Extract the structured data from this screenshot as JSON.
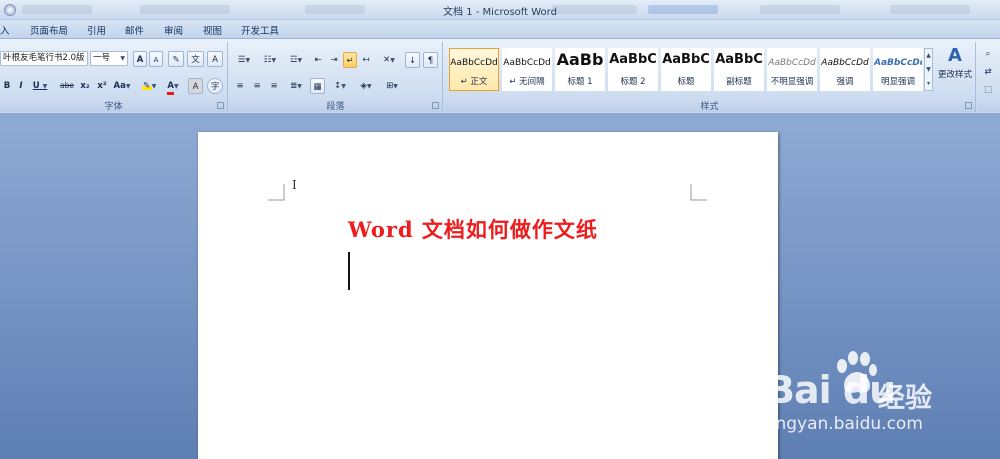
{
  "window": {
    "title": "文档 1 - Microsoft Word"
  },
  "tabs": [
    {
      "id": "insert",
      "label": "入"
    },
    {
      "id": "layout",
      "label": "页面布局"
    },
    {
      "id": "references",
      "label": "引用"
    },
    {
      "id": "mailings",
      "label": "邮件"
    },
    {
      "id": "review",
      "label": "审阅"
    },
    {
      "id": "view",
      "label": "视图"
    },
    {
      "id": "developer",
      "label": "开发工具"
    }
  ],
  "font_group": {
    "label": "字体",
    "font_name": "叶根友毛笔行书2.0版",
    "font_size": "一号",
    "grow": "A",
    "shrink": "A",
    "bold": "B",
    "italic": "I",
    "underline": "U",
    "strike": "abe",
    "subscript": "x₂",
    "superscript": "x²",
    "change_case": "Aa",
    "font_color": "A",
    "char_border": "A",
    "enclose": "字"
  },
  "paragraph_group": {
    "label": "段落"
  },
  "styles_group": {
    "label": "样式",
    "change_styles": "更改样式",
    "cards": [
      {
        "sample": "AaBbCcDd",
        "name": "↵ 正文",
        "selected": true
      },
      {
        "sample": "AaBbCcDd",
        "name": "↵ 无间隔",
        "selected": false
      },
      {
        "sample": "AaBb",
        "name": "标题 1",
        "selected": false
      },
      {
        "sample": "AaBbC",
        "name": "标题 2",
        "selected": false
      },
      {
        "sample": "AaBbC",
        "name": "标题",
        "selected": false
      },
      {
        "sample": "AaBbC",
        "name": "副标题",
        "selected": false
      },
      {
        "sample": "AaBbCcDd",
        "name": "不明显强调",
        "selected": false
      },
      {
        "sample": "AaBbCcDd",
        "name": "强调",
        "selected": false
      },
      {
        "sample": "AaBbCcDd",
        "name": "明显强调",
        "selected": false
      }
    ]
  },
  "document": {
    "title_text": "Word 文档如何做作文纸",
    "title_color": "#ee1c1c"
  },
  "watermark": {
    "logo": "Bai du",
    "cn": "经验",
    "url": "jingyan.baidu.com"
  },
  "colors": {
    "ribbon": "#d3e1f2",
    "workspace": "#6f8fbf",
    "selected_style": "#ffe8a8"
  }
}
